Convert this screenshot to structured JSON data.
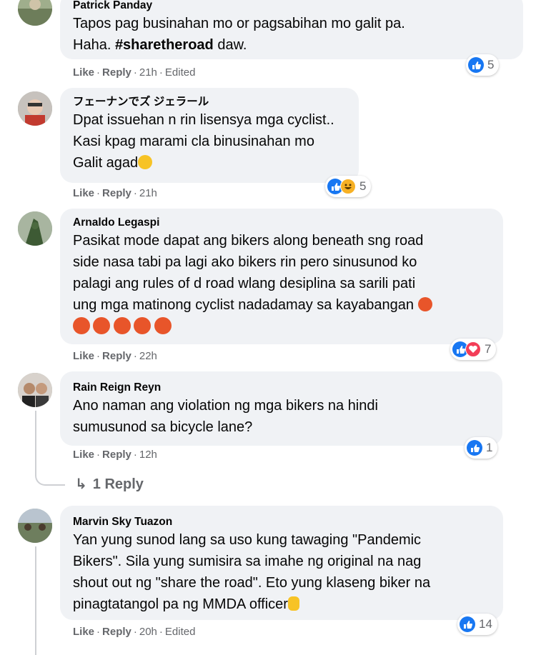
{
  "comments": [
    {
      "author": "Patrick Panday",
      "text_before": "Tapos pag businahan mo or pagsabihan mo galit pa.\nHaha. ",
      "hashtag": "#sharetheroad",
      "text_after": " daw.",
      "like": "Like",
      "reply": "Reply",
      "time": "21h",
      "edited": "Edited",
      "reaction_count": "5"
    },
    {
      "author": "フェーナンでズ ジェラール",
      "text": "Dpat issuehan n rin lisensya mga cyclist..\nKasi kpag marami cla binusinahan mo\nGalit agad",
      "like": "Like",
      "reply": "Reply",
      "time": "21h",
      "reaction_count": "5"
    },
    {
      "author": "Arnaldo Legaspi",
      "text": "Pasikat mode dapat ang bikers along beneath sng road\nside nasa tabi pa lagi ako bikers rin pero sinusunod ko\npalagi ang rules of d road wlang desiplina sa sarili pati\nung mga matinong cyclist nadadamay sa kayabangan",
      "like": "Like",
      "reply": "Reply",
      "time": "22h",
      "reaction_count": "7"
    },
    {
      "author": "Rain Reign Reyn",
      "text": "Ano naman ang violation ng mga bikers na hindi\nsumusunod sa bicycle lane?",
      "like": "Like",
      "reply": "Reply",
      "time": "12h",
      "reaction_count": "1",
      "replies_label": "1 Reply"
    },
    {
      "author": "Marvin Sky Tuazon",
      "text": "Yan yung sunod lang sa uso kung tawaging \"Pandemic\nBikers\". Sila yung sumisira sa imahe ng original na nag\nshout out ng \"share the road\". Eto yung klaseng biker na\npinagtatangol pa ng MMDA officer",
      "like": "Like",
      "reply": "Reply",
      "time": "20h",
      "edited": "Edited",
      "reaction_count": "14"
    }
  ],
  "colors": {
    "bubble": "#f0f2f5",
    "meta": "#65676b",
    "like_blue": "#1877f2",
    "love_red": "#f33e58",
    "haha_yellow": "#f7b125"
  }
}
